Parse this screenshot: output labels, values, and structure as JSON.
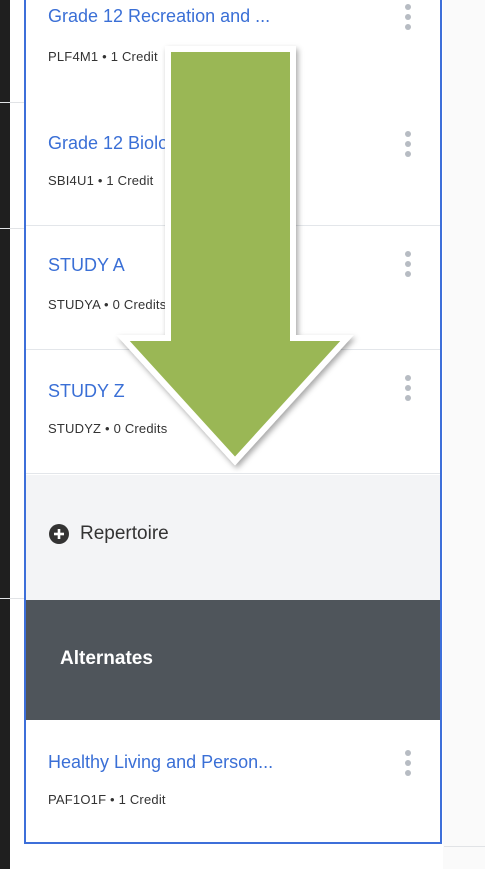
{
  "courses": [
    {
      "title": "Grade 12 Recreation and ...",
      "subtitle": "PLF4M1 • 1 Credit"
    },
    {
      "title": "Grade 12 Biology, University...",
      "subtitle": "SBI4U1 • 1 Credit"
    },
    {
      "title": "STUDY A",
      "subtitle": "STUDYA • 0 Credits"
    },
    {
      "title": "STUDY Z",
      "subtitle": "STUDYZ • 0 Credits"
    }
  ],
  "repertoire": {
    "label": "Repertoire",
    "icon": "plus-circle-icon"
  },
  "alternates": {
    "title": "Alternates",
    "courses": [
      {
        "title": "Healthy Living and Person...",
        "subtitle": "PAF1O1F • 1 Credit"
      }
    ]
  },
  "overlay": {
    "icon": "down-arrow-icon",
    "color": "#9ab755"
  },
  "colors": {
    "link": "#3a6fd6",
    "panel_border": "#3d6fd9",
    "alternates_bg": "#4f555b",
    "repertoire_bg": "#f3f4f6"
  }
}
